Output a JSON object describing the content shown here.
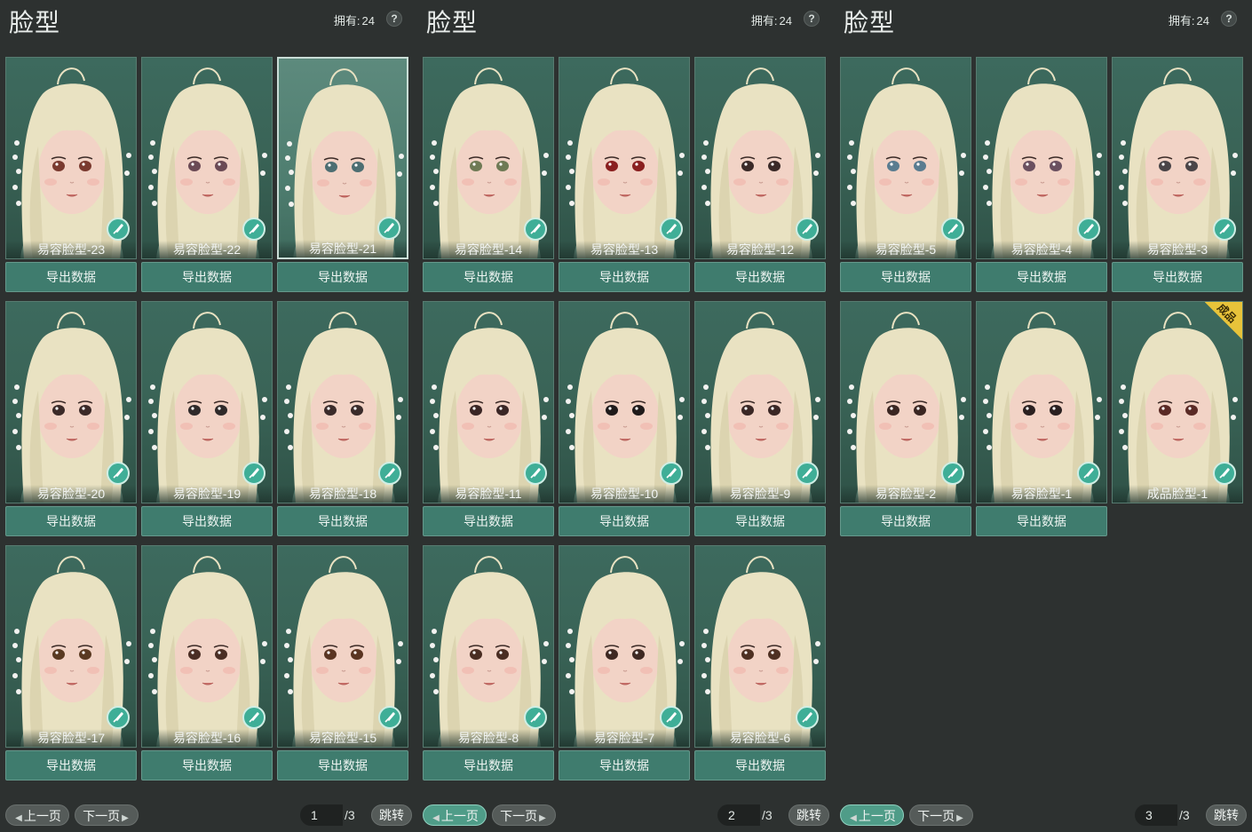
{
  "panels": [
    {
      "title": "脸型",
      "owned_label": "拥有:",
      "owned_count": "24",
      "help": "?",
      "cards": [
        {
          "name": "易容脸型-23",
          "eye": "#7a3a2f",
          "selected": false
        },
        {
          "name": "易容脸型-22",
          "eye": "#6b4a55",
          "selected": false
        },
        {
          "name": "易容脸型-21",
          "eye": "#4d6e72",
          "selected": true
        },
        {
          "name": "易容脸型-20",
          "eye": "#3b2a28",
          "selected": false
        },
        {
          "name": "易容脸型-19",
          "eye": "#2f2a2a",
          "selected": false
        },
        {
          "name": "易容脸型-18",
          "eye": "#3a2b2a",
          "selected": false
        },
        {
          "name": "易容脸型-17",
          "eye": "#5a3a22",
          "selected": false
        },
        {
          "name": "易容脸型-16",
          "eye": "#4a2e24",
          "selected": false
        },
        {
          "name": "易容脸型-15",
          "eye": "#5a3522",
          "selected": false
        }
      ],
      "export_label": "导出数据",
      "pager": {
        "prev": "上一页",
        "next": "下一页",
        "page": "1",
        "total": "/3",
        "jump": "跳转",
        "active": "none"
      }
    },
    {
      "title": "脸型",
      "owned_label": "拥有:",
      "owned_count": "24",
      "help": "?",
      "cards": [
        {
          "name": "易容脸型-14",
          "eye": "#6f7a55",
          "selected": false
        },
        {
          "name": "易容脸型-13",
          "eye": "#8a1f1f",
          "selected": false
        },
        {
          "name": "易容脸型-12",
          "eye": "#3a2a28",
          "selected": false
        },
        {
          "name": "易容脸型-11",
          "eye": "#3a2625",
          "selected": false
        },
        {
          "name": "易容脸型-10",
          "eye": "#1f1a1a",
          "selected": false
        },
        {
          "name": "易容脸型-9",
          "eye": "#3a2725",
          "selected": false
        },
        {
          "name": "易容脸型-8",
          "eye": "#4a2d22",
          "selected": false
        },
        {
          "name": "易容脸型-7",
          "eye": "#3e2822",
          "selected": false
        },
        {
          "name": "易容脸型-6",
          "eye": "#4e3022",
          "selected": false
        }
      ],
      "export_label": "导出数据",
      "pager": {
        "prev": "上一页",
        "next": "下一页",
        "page": "2",
        "total": "/3",
        "jump": "跳转",
        "active": "prev"
      }
    },
    {
      "title": "脸型",
      "owned_label": "拥有:",
      "owned_count": "24",
      "help": "?",
      "cards": [
        {
          "name": "易容脸型-5",
          "eye": "#5a7c90",
          "selected": false
        },
        {
          "name": "易容脸型-4",
          "eye": "#6a5060",
          "selected": false
        },
        {
          "name": "易容脸型-3",
          "eye": "#4a4548",
          "selected": false
        },
        {
          "name": "易容脸型-2",
          "eye": "#3a2622",
          "selected": false
        },
        {
          "name": "易容脸型-1",
          "eye": "#2a2020",
          "selected": false
        },
        {
          "name": "成品脸型-1",
          "eye": "#5a2a25",
          "selected": false,
          "tag": "成品",
          "no_export": true
        }
      ],
      "export_label": "导出数据",
      "pager": {
        "prev": "上一页",
        "next": "下一页",
        "page": "3",
        "total": "/3",
        "jump": "跳转",
        "active": "prev"
      }
    }
  ],
  "colors": {
    "hair": "#e9e2c2",
    "skin": "#f2d3c6",
    "accent": "#3fae97"
  },
  "icons": {
    "edit": "brush-edit-icon",
    "help": "help-icon"
  }
}
